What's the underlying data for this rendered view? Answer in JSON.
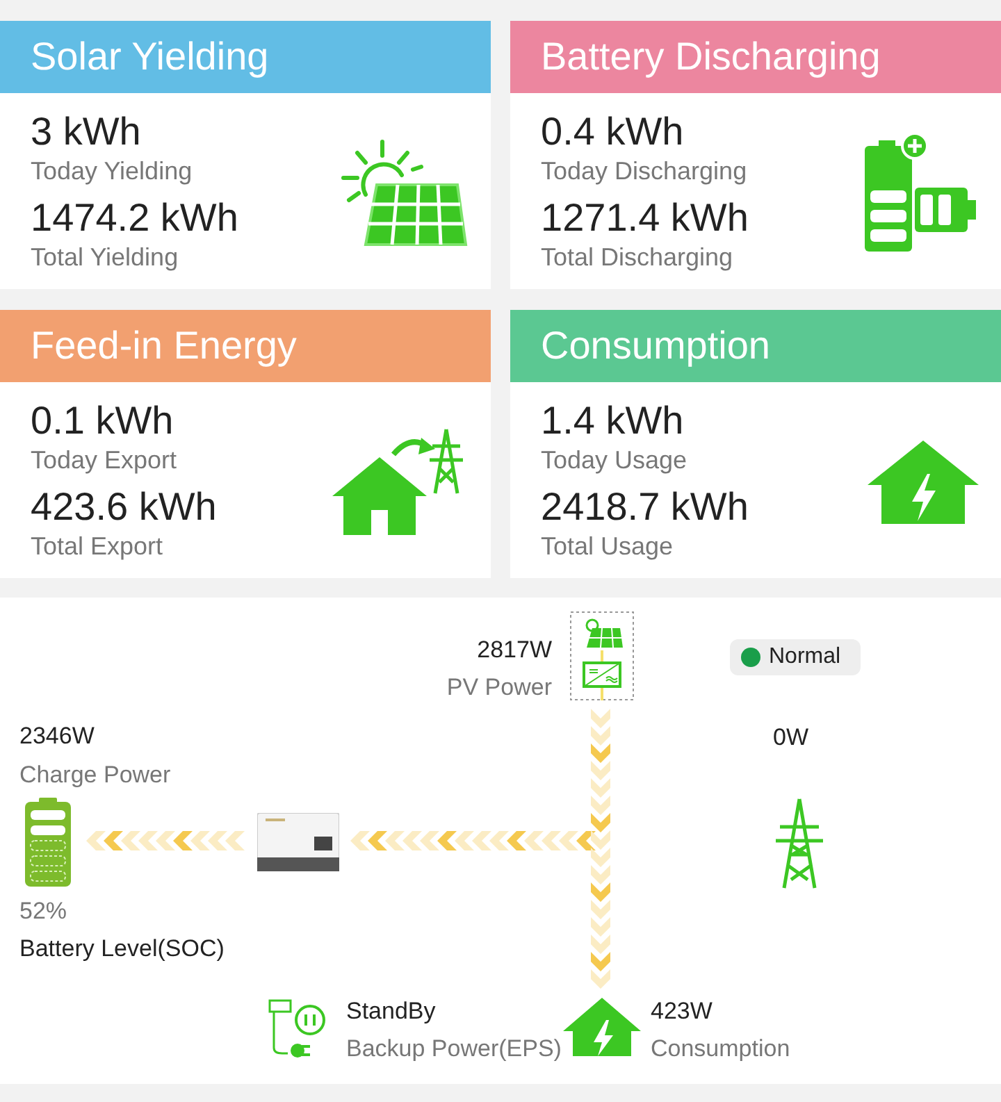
{
  "cards": [
    {
      "kind": "solar",
      "title": "Solar Yielding",
      "color": "#62bde5",
      "today_value": "3 kWh",
      "today_label": "Today Yielding",
      "total_value": "1474.2 kWh",
      "total_label": "Total Yielding"
    },
    {
      "kind": "battery",
      "title": "Battery Discharging",
      "color": "#ec869f",
      "today_value": "0.4 kWh",
      "today_label": "Today Discharging",
      "total_value": "1271.4 kWh",
      "total_label": "Total Discharging"
    },
    {
      "kind": "feed_in",
      "title": "Feed-in Energy",
      "color": "#f2a070",
      "today_value": "0.1 kWh",
      "today_label": "Today Export",
      "total_value": "423.6 kWh",
      "total_label": "Total Export"
    },
    {
      "kind": "consumption",
      "title": "Consumption",
      "color": "#5bc892",
      "today_value": "1.4 kWh",
      "today_label": "Today Usage",
      "total_value": "2418.7 kWh",
      "total_label": "Total Usage"
    }
  ],
  "flow": {
    "pv": {
      "value": "2817W",
      "label": "PV Power"
    },
    "status": {
      "label": "Normal",
      "color": "#1a9e4a"
    },
    "grid": {
      "value": "0W"
    },
    "battery": {
      "value": "2346W",
      "label": "Charge Power",
      "soc": "52%",
      "soc_label": "Battery Level(SOC)"
    },
    "eps": {
      "value": "StandBy",
      "label": "Backup Power(EPS)"
    },
    "load": {
      "value": "423W",
      "label": "Consumption"
    }
  }
}
